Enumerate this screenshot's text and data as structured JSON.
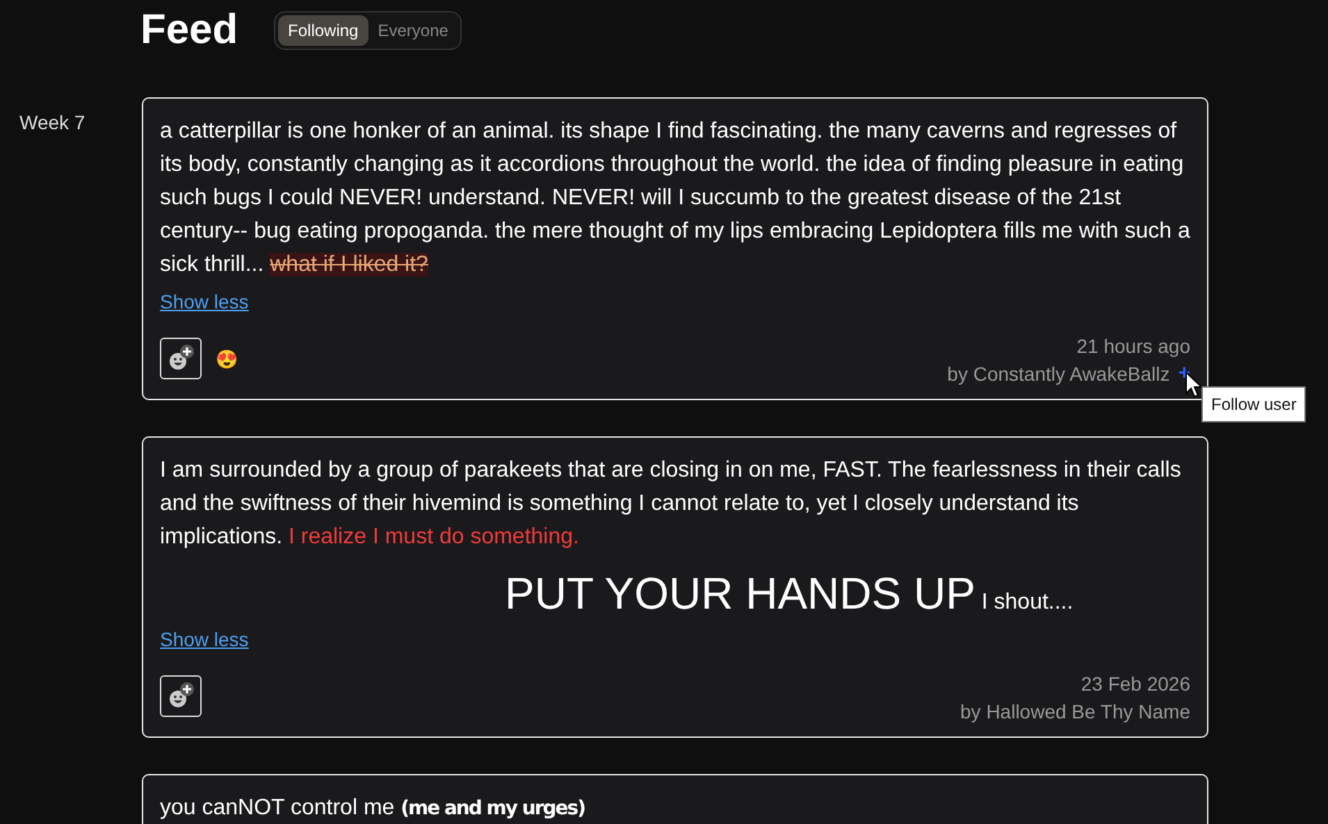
{
  "header": {
    "title": "Feed",
    "tabs": [
      {
        "label": "Following",
        "selected": true
      },
      {
        "label": "Everyone",
        "selected": false
      }
    ]
  },
  "week_label": "Week 7",
  "posts": [
    {
      "segments": [
        {
          "kind": "plain",
          "text": "a catterpillar is one honker of an animal. its shape I find fascinating. the many caverns and regresses of its body, constantly changing as it accordions throughout the world. the idea of finding pleasure in eating such bugs I could NEVER! understand. NEVER! will I succumb to the greatest disease of the 21st century-- bug eating propoganda. the mere thought of my lips embracing Lepidoptera fills me with such a sick thrill... "
        },
        {
          "kind": "strike",
          "text": "what if I liked it?"
        }
      ],
      "toggle": "Show less",
      "reactions": [
        "😍"
      ],
      "time": "21 hours ago",
      "author": "by Constantly AwakeBallz",
      "follow_button": "+",
      "tooltip": "Follow user"
    },
    {
      "segments": [
        {
          "kind": "plain",
          "text": "I am surrounded by a group of parakeets that are closing in on me, FAST. The fearlessness in their calls and the swiftness of their hivemind is something I cannot relate to, yet I closely understand its implications. "
        },
        {
          "kind": "red",
          "text": "I realize I must do something."
        },
        {
          "kind": "break"
        },
        {
          "kind": "big",
          "text": "PUT YOUR HANDS UP"
        },
        {
          "kind": "small",
          "text": " I shout...."
        }
      ],
      "toggle": "Show less",
      "time": "23 Feb 2026",
      "author": "by Hallowed Be Thy Name"
    },
    {
      "segments": [
        {
          "kind": "plain",
          "text": "you canNOT control me "
        },
        {
          "kind": "condensed",
          "text": "(me and my urges)"
        }
      ]
    }
  ]
}
